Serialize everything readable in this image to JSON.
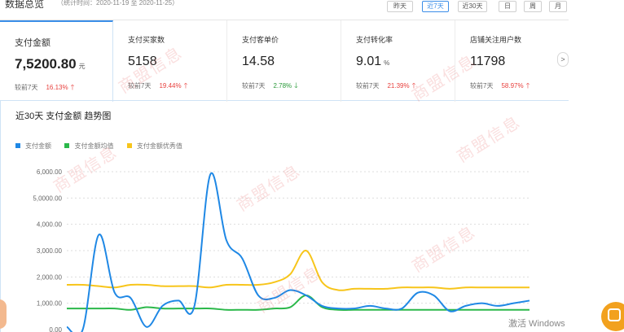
{
  "header": {
    "title": "数据总览",
    "date_range": "（统计时间：2020-11-19 至 2020-11-25）"
  },
  "period_tabs": [
    "昨天",
    "近7天",
    "近30天",
    "日",
    "周",
    "月"
  ],
  "period_active_index": 1,
  "metrics": [
    {
      "label": "支付金额",
      "value": "7,5200.80",
      "unit": "元",
      "compare_label": "较前7天",
      "pct": "16.13%",
      "direction": "up"
    },
    {
      "label": "支付买家数",
      "value": "5158",
      "unit": "",
      "compare_label": "较前7天",
      "pct": "19.44%",
      "direction": "up"
    },
    {
      "label": "支付客单价",
      "value": "14.58",
      "unit": "",
      "compare_label": "较前7天",
      "pct": "2.78%",
      "direction": "down"
    },
    {
      "label": "支付转化率",
      "value": "9.01",
      "unit": "%",
      "compare_label": "较前7天",
      "pct": "21.39%",
      "direction": "up"
    },
    {
      "label": "店铺关注用户数",
      "value": "11798",
      "unit": "",
      "compare_label": "较前7天",
      "pct": "58.97%",
      "direction": "up"
    }
  ],
  "next_icon": "chevron-right-icon",
  "chart_title": "近30天 支付金额 趋势图",
  "chart_data": {
    "type": "line",
    "title": "近30天 支付金额 趋势图",
    "xlabel": "",
    "ylabel": "",
    "ylim": [
      0,
      6000
    ],
    "y_ticks": [
      "0.00",
      "1,000.00",
      "2,000.00",
      "3,000.00",
      "4,000.00",
      "5,0000.00",
      "6,000.00"
    ],
    "grid": true,
    "legend_position": "top-left",
    "x": [
      0,
      1,
      2,
      3,
      4,
      5,
      6,
      7,
      8,
      9,
      10,
      11,
      12,
      13,
      14,
      15,
      16,
      17,
      18,
      19,
      20,
      21,
      22,
      23,
      24,
      25,
      26,
      27,
      28,
      29
    ],
    "series": [
      {
        "name": "支付金额",
        "color": "#1f88e5",
        "values": [
          100,
          0,
          3600,
          1400,
          1200,
          100,
          900,
          1100,
          900,
          5900,
          3400,
          2700,
          1300,
          1200,
          1500,
          1300,
          900,
          800,
          800,
          900,
          800,
          800,
          1400,
          1300,
          700,
          900,
          1000,
          900,
          1000,
          1100
        ]
      },
      {
        "name": "支付金额均值",
        "color": "#2bb84a",
        "values": [
          800,
          800,
          800,
          800,
          750,
          850,
          800,
          800,
          800,
          800,
          750,
          750,
          750,
          800,
          850,
          1300,
          850,
          750,
          750,
          750,
          750,
          750,
          750,
          750,
          750,
          750,
          750,
          750,
          750,
          750
        ]
      },
      {
        "name": "支付金额优秀值",
        "color": "#f7c51b",
        "values": [
          1700,
          1700,
          1650,
          1600,
          1700,
          1700,
          1650,
          1650,
          1650,
          1600,
          1700,
          1700,
          1700,
          1800,
          2100,
          3000,
          1800,
          1500,
          1550,
          1550,
          1550,
          1600,
          1600,
          1600,
          1550,
          1600,
          1600,
          1600,
          1600,
          1600
        ]
      }
    ]
  },
  "watermark_text": "商盟信息",
  "activate_windows_text": "激活 Windows"
}
